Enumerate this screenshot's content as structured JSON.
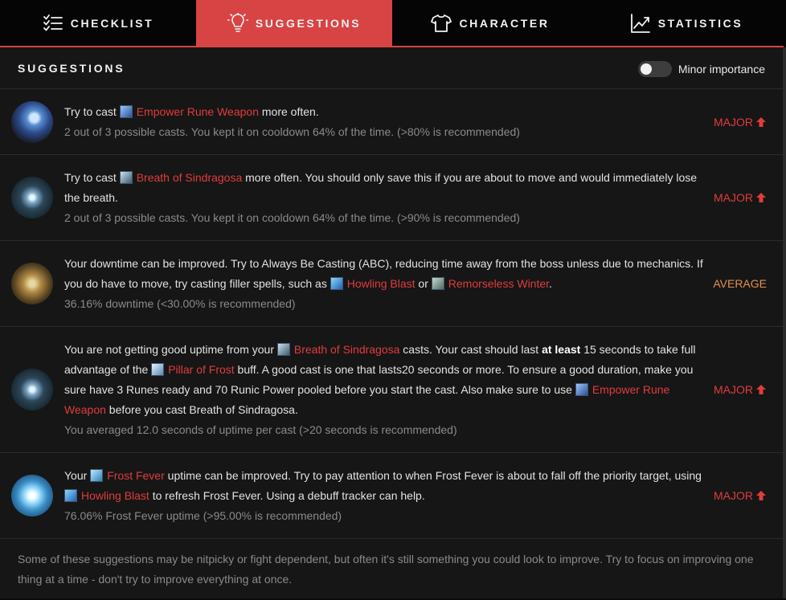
{
  "tabs": [
    {
      "label": "CHECKLIST",
      "icon": "checklist-icon",
      "active": false
    },
    {
      "label": "SUGGESTIONS",
      "icon": "lightbulb-icon",
      "active": true
    },
    {
      "label": "CHARACTER",
      "icon": "shirt-icon",
      "active": false
    },
    {
      "label": "STATISTICS",
      "icon": "line-chart-icon",
      "active": false
    }
  ],
  "colors": {
    "accent": "#d84343",
    "spell": "#e03c3c",
    "major": "#e03c3c",
    "average": "#e5904c"
  },
  "header": {
    "title": "SUGGESTIONS",
    "toggle_label": "Minor importance",
    "toggle_on": false
  },
  "suggestions": [
    {
      "icon": "empower-rune-weapon-icon",
      "t1": "Try to cast ",
      "spell1": "Empower Rune Weapon",
      "t2": " more often.",
      "stat": "2 out of 3 possible casts. You kept it on cooldown 64% of the time. (>80% is recommended)",
      "importance": "MAJOR"
    },
    {
      "icon": "breath-of-sindragosa-icon",
      "t1": "Try to cast ",
      "spell1": "Breath of Sindragosa",
      "t2": " more often. You should only save this if you are about to move and would immediately lose the breath.",
      "stat": "2 out of 3 possible casts. You kept it on cooldown 64% of the time. (>90% is recommended)",
      "importance": "MAJOR"
    },
    {
      "icon": "always-be-casting-icon",
      "t1": "Your downtime can be improved. Try to Always Be Casting (ABC), reducing time away from the boss unless due to mechanics. If you do have to move, try casting filler spells, such as ",
      "spell1": "Howling Blast",
      "t2": " or ",
      "spell2": "Remorseless Winter",
      "t3": ".",
      "stat": "36.16% downtime (<30.00% is recommended)",
      "importance": "AVERAGE"
    },
    {
      "icon": "breath-of-sindragosa-icon",
      "t1": "You are not getting good uptime from your ",
      "spell1": "Breath of Sindragosa",
      "t2": " casts. Your cast should last ",
      "bold": "at least",
      "t3": " 15 seconds to take full advantage of the ",
      "spell2": "Pillar of Frost",
      "t4": " buff. A good cast is one that lasts20 seconds or more. To ensure a good duration, make you sure have 3 Runes ready and 70 Runic Power pooled before you start the cast. Also make sure to use ",
      "spell3": "Empower Rune Weapon",
      "t5": " before you cast Breath of Sindragosa.",
      "stat": "You averaged 12.0 seconds of uptime per cast (>20 seconds is recommended)",
      "importance": "MAJOR"
    },
    {
      "icon": "frost-fever-icon",
      "t1": "Your ",
      "spell1": "Frost Fever",
      "t2": " uptime can be improved. Try to pay attention to when Frost Fever is about to fall off the priority target, using ",
      "spell2": "Howling Blast",
      "t3": " to refresh Frost Fever. Using a debuff tracker can help.",
      "stat": "76.06% Frost Fever uptime (>95.00% is recommended)",
      "importance": "MAJOR"
    }
  ],
  "footer": "Some of these suggestions may be nitpicky or fight dependent, but often it's still something you could look to improve. Try to focus on improving one thing at a time - don't try to improve everything at once."
}
